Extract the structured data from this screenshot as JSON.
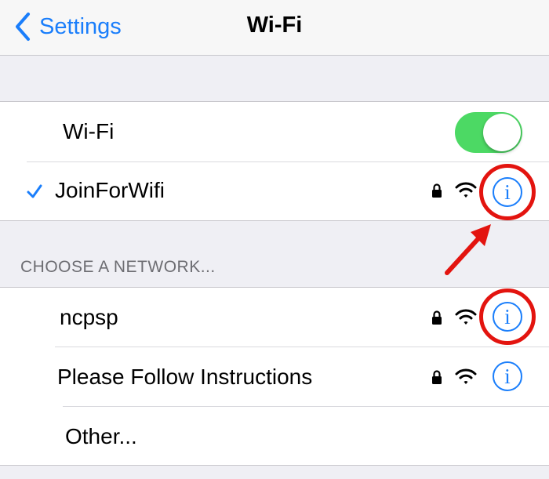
{
  "navbar": {
    "back_label": "Settings",
    "title": "Wi-Fi"
  },
  "wifi_toggle": {
    "label": "Wi-Fi",
    "on": true
  },
  "connected_network": {
    "name": "JoinForWifi",
    "secured": true,
    "info_glyph": "i"
  },
  "choose_section": {
    "header": "CHOOSE A NETWORK..."
  },
  "networks": [
    {
      "name": "ncpsp",
      "secured": true,
      "info_glyph": "i"
    },
    {
      "name": "Please Follow Instructions",
      "secured": true,
      "info_glyph": "i"
    }
  ],
  "other_label": "Other...",
  "colors": {
    "accent": "#1a7efb",
    "toggle_on": "#4cd964",
    "annotation_red": "#e3140f",
    "background": "#efeff4"
  },
  "icons": {
    "back": "chevron-left-icon",
    "check": "checkmark-icon",
    "lock": "lock-icon",
    "wifi": "wifi-signal-icon",
    "info": "info-icon",
    "annotation_arrow": "red-arrow-icon"
  }
}
